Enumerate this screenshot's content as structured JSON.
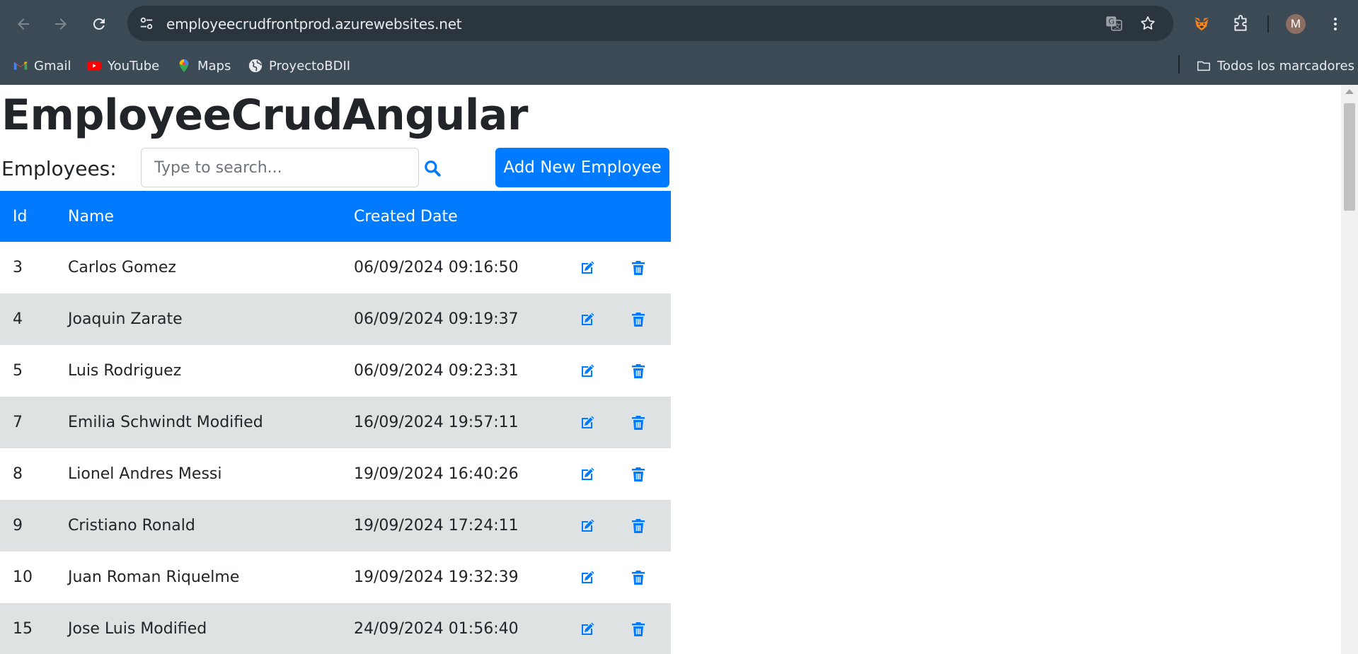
{
  "browser": {
    "url": "employeecrudfrontprod.azurewebsites.net",
    "profile_initial": "M",
    "bookmarks": [
      {
        "label": "Gmail",
        "icon": "gmail-icon"
      },
      {
        "label": "YouTube",
        "icon": "youtube-icon"
      },
      {
        "label": "Maps",
        "icon": "maps-icon"
      },
      {
        "label": "ProyectoBDII",
        "icon": "globe-icon"
      }
    ],
    "all_bookmarks_label": "Todos los marcadores"
  },
  "app": {
    "title": "EmployeeCrudAngular",
    "employees_label": "Employees:",
    "search_placeholder": "Type to search...",
    "add_button_label": "Add New Employee",
    "accent_color": "#007bff"
  },
  "table": {
    "headers": {
      "id": "Id",
      "name": "Name",
      "created": "Created Date"
    },
    "rows": [
      {
        "id": "3",
        "name": "Carlos Gomez",
        "created": "06/09/2024 09:16:50"
      },
      {
        "id": "4",
        "name": "Joaquin Zarate",
        "created": "06/09/2024 09:19:37"
      },
      {
        "id": "5",
        "name": "Luis Rodriguez",
        "created": "06/09/2024 09:23:31"
      },
      {
        "id": "7",
        "name": "Emilia Schwindt Modified",
        "created": "16/09/2024 19:57:11"
      },
      {
        "id": "8",
        "name": "Lionel Andres Messi",
        "created": "19/09/2024 16:40:26"
      },
      {
        "id": "9",
        "name": "Cristiano Ronald",
        "created": "19/09/2024 17:24:11"
      },
      {
        "id": "10",
        "name": "Juan Roman Riquelme",
        "created": "19/09/2024 19:32:39"
      },
      {
        "id": "15",
        "name": "Jose Luis Modified",
        "created": "24/09/2024 01:56:40"
      }
    ]
  }
}
